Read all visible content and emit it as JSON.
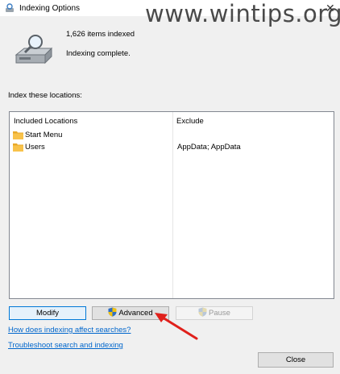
{
  "window": {
    "title": "Indexing Options",
    "watermark": "www.wintips.org"
  },
  "summary": {
    "items_indexed": "1,626 items indexed",
    "status": "Indexing complete."
  },
  "locations": {
    "heading": "Index these locations:",
    "columns": {
      "included": "Included Locations",
      "exclude": "Exclude"
    },
    "rows": [
      {
        "location": "Start Menu",
        "exclude": ""
      },
      {
        "location": "Users",
        "exclude": "AppData; AppData"
      }
    ]
  },
  "buttons": {
    "modify": "Modify",
    "advanced": "Advanced",
    "pause": "Pause",
    "close": "Close"
  },
  "links": {
    "how_affects": "How does indexing affect searches?",
    "troubleshoot": "Troubleshoot search and indexing"
  },
  "colors": {
    "accent": "#0078d7",
    "link": "#0066cc",
    "annotation_arrow": "#e0201b",
    "folder": "#f8c24a"
  },
  "icons": [
    "indexing-options-icon",
    "hard-disk-magnifier-icon",
    "folder-icon",
    "uac-shield-icon",
    "close-icon"
  ]
}
